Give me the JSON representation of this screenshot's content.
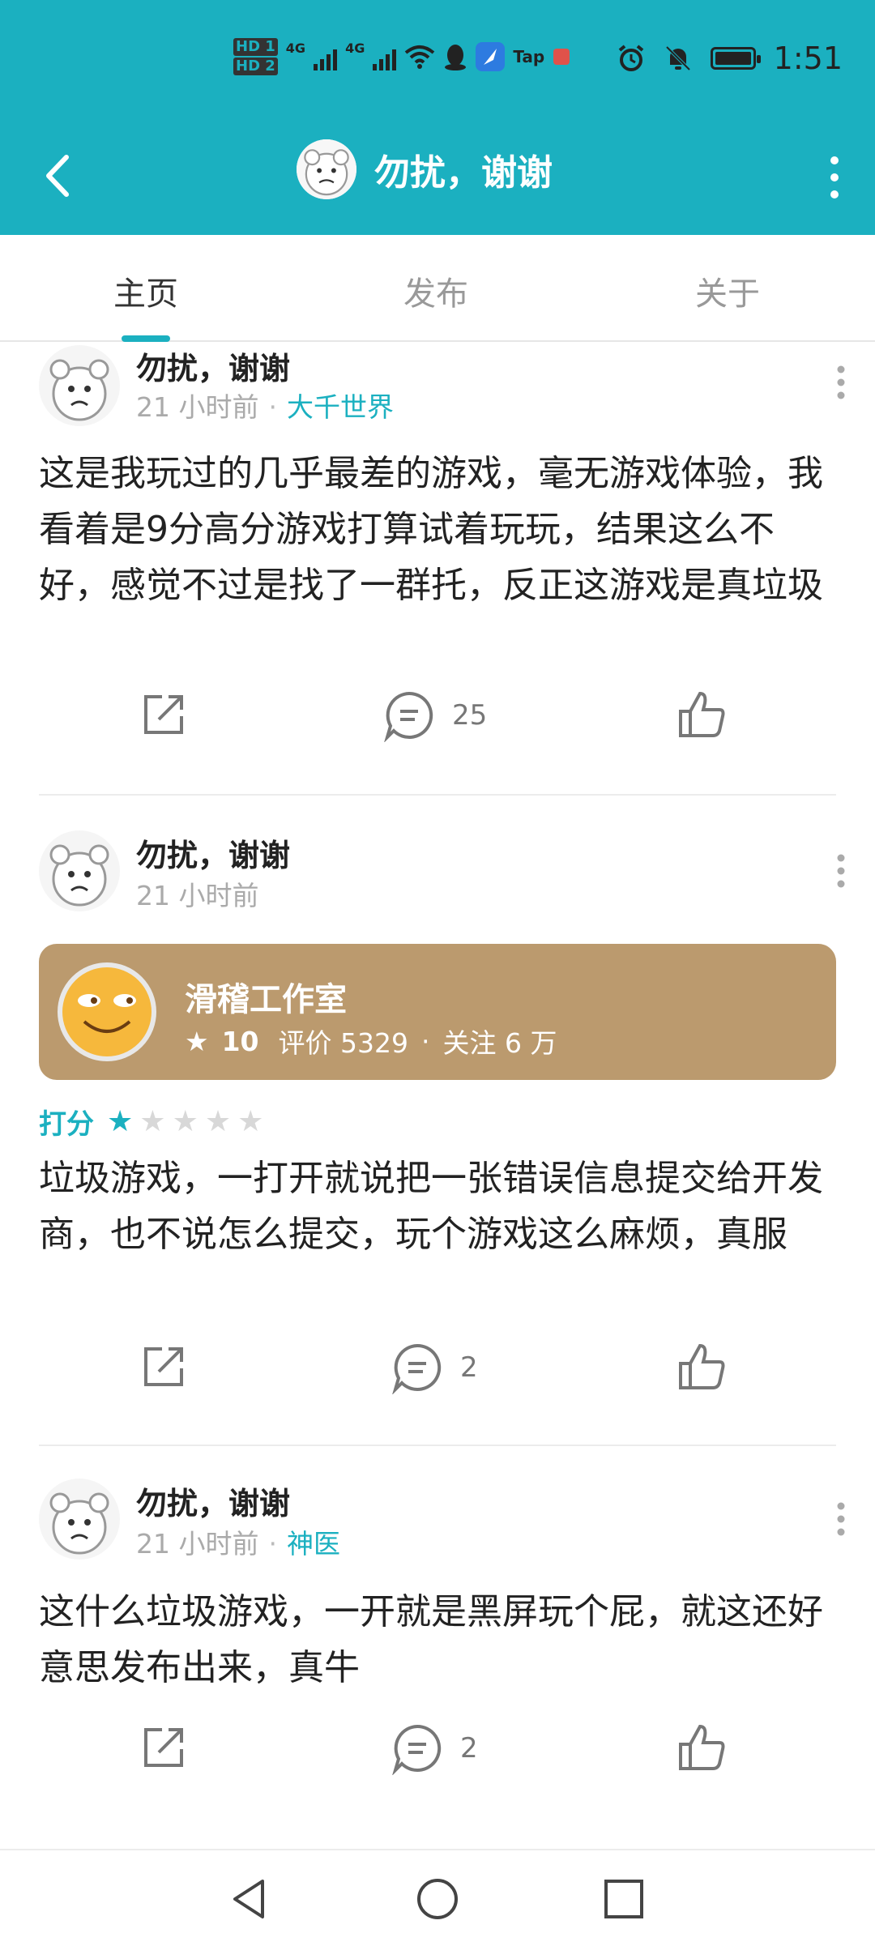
{
  "status_bar": {
    "time": "1:51",
    "hd1": "HD 1",
    "hd2": "HD 2",
    "net1": "4G",
    "net2": "4G",
    "tap_label": "Tap"
  },
  "app_bar": {
    "title": "勿扰，谢谢",
    "accent_color": "#1bb0c0"
  },
  "tabs": [
    {
      "label": "主页",
      "active": true
    },
    {
      "label": "发布",
      "active": false
    },
    {
      "label": "关于",
      "active": false
    }
  ],
  "posts": [
    {
      "author": "勿扰，谢谢",
      "time": "21 小时前",
      "separator": "·",
      "tag": "大千世界",
      "content": "这是我玩过的几乎最差的游戏，毫无游戏体验，我看着是9分高分游戏打算试着玩玩，结果这么不好，感觉不过是找了一群托，反正这游戏是真垃圾",
      "comments": "25"
    },
    {
      "author": "勿扰，谢谢",
      "time": "21 小时前",
      "game": {
        "name": "滑稽工作室",
        "score": "10",
        "reviews_label": "评价 5329",
        "dot": "·",
        "follows_label": "关注 6 万"
      },
      "rating_label": "打分",
      "rating": 1,
      "rating_max": 5,
      "content": "垃圾游戏，一打开就说把一张错误信息提交给开发商，也不说怎么提交，玩个游戏这么麻烦，真服",
      "comments": "2"
    },
    {
      "author": "勿扰，谢谢",
      "time": "21 小时前",
      "separator": "·",
      "tag": "神医",
      "content": "这什么垃圾游戏，一开就是黑屏玩个屁，就这还好意思发布出来，真牛",
      "comments": "2"
    }
  ],
  "icons": {
    "share": "share-icon",
    "comment": "comment-icon",
    "like": "thumbs-up-icon",
    "more": "more-vertical-icon",
    "back": "back-arrow-icon"
  }
}
